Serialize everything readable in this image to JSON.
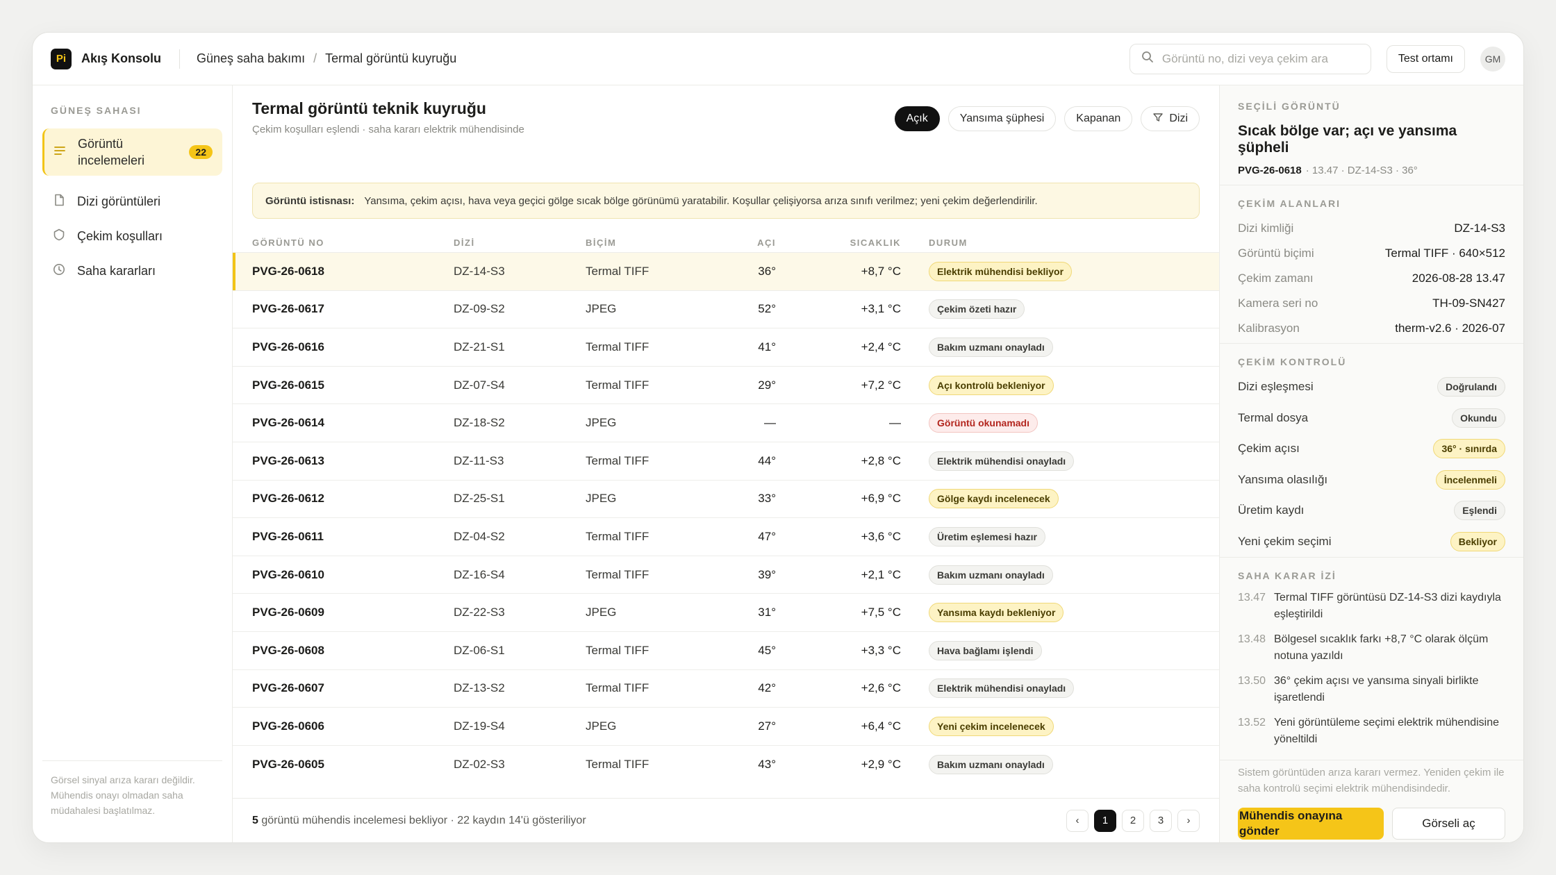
{
  "app": {
    "logo": "Pi",
    "name": "Akış Konsolu"
  },
  "breadcrumb": [
    "Güneş saha bakımı",
    "Termal görüntü kuyruğu"
  ],
  "search": {
    "placeholder": "Görüntü no, dizi veya çekim ara"
  },
  "env_button": "Test ortamı",
  "user_initials": "GM",
  "sidebar": {
    "section": "GÜNEŞ SAHASI",
    "items": [
      {
        "label": "Görüntü incelemeleri",
        "badge": "22",
        "icon": "list-icon"
      },
      {
        "label": "Dizi görüntüleri",
        "icon": "document-icon"
      },
      {
        "label": "Çekim koşulları",
        "icon": "shield-icon"
      },
      {
        "label": "Saha kararları",
        "icon": "clock-icon"
      }
    ],
    "footer": "Görsel sinyal arıza kararı değildir. Mühendis onayı olmadan saha müdahalesi başlatılmaz."
  },
  "main": {
    "title": "Termal görüntü teknik kuyruğu",
    "subtitle": "Çekim koşulları eşlendi · saha kararı elektrik mühendisinde",
    "filters": [
      "Açık",
      "Yansıma şüphesi",
      "Kapanan",
      "Dizi"
    ],
    "banner_title": "Görüntü istisnası:",
    "banner_text": "Yansıma, çekim açısı, hava veya geçici gölge sıcak bölge görünümü yaratabilir. Koşullar çelişiyorsa arıza sınıfı verilmez; yeni çekim değerlendirilir.",
    "columns": [
      "GÖRÜNTÜ NO",
      "DİZİ",
      "BİÇİM",
      "AÇI",
      "SICAKLIK",
      "DURUM"
    ],
    "rows": [
      {
        "id": "PVG-26-0618",
        "dizi": "DZ-14-S3",
        "bicim": "Termal TIFF",
        "aci": "36°",
        "sicaklik": "+8,7 °C",
        "durum": "Elektrik mühendisi bekliyor",
        "tone": "yellow"
      },
      {
        "id": "PVG-26-0617",
        "dizi": "DZ-09-S2",
        "bicim": "JPEG",
        "aci": "52°",
        "sicaklik": "+3,1 °C",
        "durum": "Çekim özeti hazır",
        "tone": "gray"
      },
      {
        "id": "PVG-26-0616",
        "dizi": "DZ-21-S1",
        "bicim": "Termal TIFF",
        "aci": "41°",
        "sicaklik": "+2,4 °C",
        "durum": "Bakım uzmanı onayladı",
        "tone": "gray"
      },
      {
        "id": "PVG-26-0615",
        "dizi": "DZ-07-S4",
        "bicim": "Termal TIFF",
        "aci": "29°",
        "sicaklik": "+7,2 °C",
        "durum": "Açı kontrolü bekleniyor",
        "tone": "yellow"
      },
      {
        "id": "PVG-26-0614",
        "dizi": "DZ-18-S2",
        "bicim": "JPEG",
        "aci": "—",
        "sicaklik": "—",
        "durum": "Görüntü okunamadı",
        "tone": "red"
      },
      {
        "id": "PVG-26-0613",
        "dizi": "DZ-11-S3",
        "bicim": "Termal TIFF",
        "aci": "44°",
        "sicaklik": "+2,8 °C",
        "durum": "Elektrik mühendisi onayladı",
        "tone": "gray"
      },
      {
        "id": "PVG-26-0612",
        "dizi": "DZ-25-S1",
        "bicim": "JPEG",
        "aci": "33°",
        "sicaklik": "+6,9 °C",
        "durum": "Gölge kaydı incelenecek",
        "tone": "yellow"
      },
      {
        "id": "PVG-26-0611",
        "dizi": "DZ-04-S2",
        "bicim": "Termal TIFF",
        "aci": "47°",
        "sicaklik": "+3,6 °C",
        "durum": "Üretim eşlemesi hazır",
        "tone": "gray"
      },
      {
        "id": "PVG-26-0610",
        "dizi": "DZ-16-S4",
        "bicim": "Termal TIFF",
        "aci": "39°",
        "sicaklik": "+2,1 °C",
        "durum": "Bakım uzmanı onayladı",
        "tone": "gray"
      },
      {
        "id": "PVG-26-0609",
        "dizi": "DZ-22-S3",
        "bicim": "JPEG",
        "aci": "31°",
        "sicaklik": "+7,5 °C",
        "durum": "Yansıma kaydı bekleniyor",
        "tone": "yellow"
      },
      {
        "id": "PVG-26-0608",
        "dizi": "DZ-06-S1",
        "bicim": "Termal TIFF",
        "aci": "45°",
        "sicaklik": "+3,3 °C",
        "durum": "Hava bağlamı işlendi",
        "tone": "gray"
      },
      {
        "id": "PVG-26-0607",
        "dizi": "DZ-13-S2",
        "bicim": "Termal TIFF",
        "aci": "42°",
        "sicaklik": "+2,6 °C",
        "durum": "Elektrik mühendisi onayladı",
        "tone": "gray"
      },
      {
        "id": "PVG-26-0606",
        "dizi": "DZ-19-S4",
        "bicim": "JPEG",
        "aci": "27°",
        "sicaklik": "+6,4 °C",
        "durum": "Yeni çekim incelenecek",
        "tone": "yellow"
      },
      {
        "id": "PVG-26-0605",
        "dizi": "DZ-02-S3",
        "bicim": "Termal TIFF",
        "aci": "43°",
        "sicaklik": "+2,9 °C",
        "durum": "Bakım uzmanı onayladı",
        "tone": "gray"
      }
    ],
    "footer_count": "5",
    "footer_text": " görüntü mühendis incelemesi bekliyor · 22 kaydın 14'ü gösteriliyor",
    "pages": [
      "1",
      "2",
      "3"
    ],
    "current_page": "1"
  },
  "panel": {
    "label": "SEÇİLİ GÖRÜNTÜ",
    "title": "Sıcak bölge var; açı ve yansıma şüpheli",
    "image_id": "PVG-26-0618",
    "meta": "· 13.47 · DZ-14-S3 · 36°",
    "fields_label": "ÇEKİM ALANLARI",
    "fields": [
      {
        "k": "Dizi kimliği",
        "v": "DZ-14-S3"
      },
      {
        "k": "Görüntü biçimi",
        "v": "Termal TIFF · 640×512"
      },
      {
        "k": "Çekim zamanı",
        "v": "2026-08-28 13.47"
      },
      {
        "k": "Kamera seri no",
        "v": "TH-09-SN427"
      },
      {
        "k": "Kalibrasyon",
        "v": "therm-v2.6 · 2026-07"
      }
    ],
    "checks_label": "ÇEKİM KONTROLÜ",
    "checks": [
      {
        "k": "Dizi eşleşmesi",
        "v": "Doğrulandı",
        "tone": "gray"
      },
      {
        "k": "Termal dosya",
        "v": "Okundu",
        "tone": "gray"
      },
      {
        "k": "Çekim açısı",
        "v": "36° · sınırda",
        "tone": "yellow"
      },
      {
        "k": "Yansıma olasılığı",
        "v": "İncelenmeli",
        "tone": "yellow"
      },
      {
        "k": "Üretim kaydı",
        "v": "Eşlendi",
        "tone": "gray"
      },
      {
        "k": "Yeni çekim seçimi",
        "v": "Bekliyor",
        "tone": "yellow"
      }
    ],
    "log_label": "SAHA KARAR İZİ",
    "log": [
      {
        "t": "13.47",
        "text": "Termal TIFF görüntüsü DZ-14-S3 dizi kaydıyla eşleştirildi"
      },
      {
        "t": "13.48",
        "text": "Bölgesel sıcaklık farkı +8,7 °C olarak ölçüm notuna yazıldı"
      },
      {
        "t": "13.50",
        "text": "36° çekim açısı ve yansıma sinyali birlikte işaretlendi"
      },
      {
        "t": "13.52",
        "text": "Yeni görüntüleme seçimi elektrik mühendisine yöneltildi"
      }
    ],
    "note": "Sistem görüntüden arıza kararı vermez. Yeniden çekim ile saha kontrolü seçimi elektrik mühendisindedir.",
    "primary_button": "Mühendis onayına gönder",
    "secondary_button": "Görseli aç"
  },
  "colors": {
    "accent": "#f5c518",
    "dark": "#111111",
    "danger": "#b3261e"
  }
}
